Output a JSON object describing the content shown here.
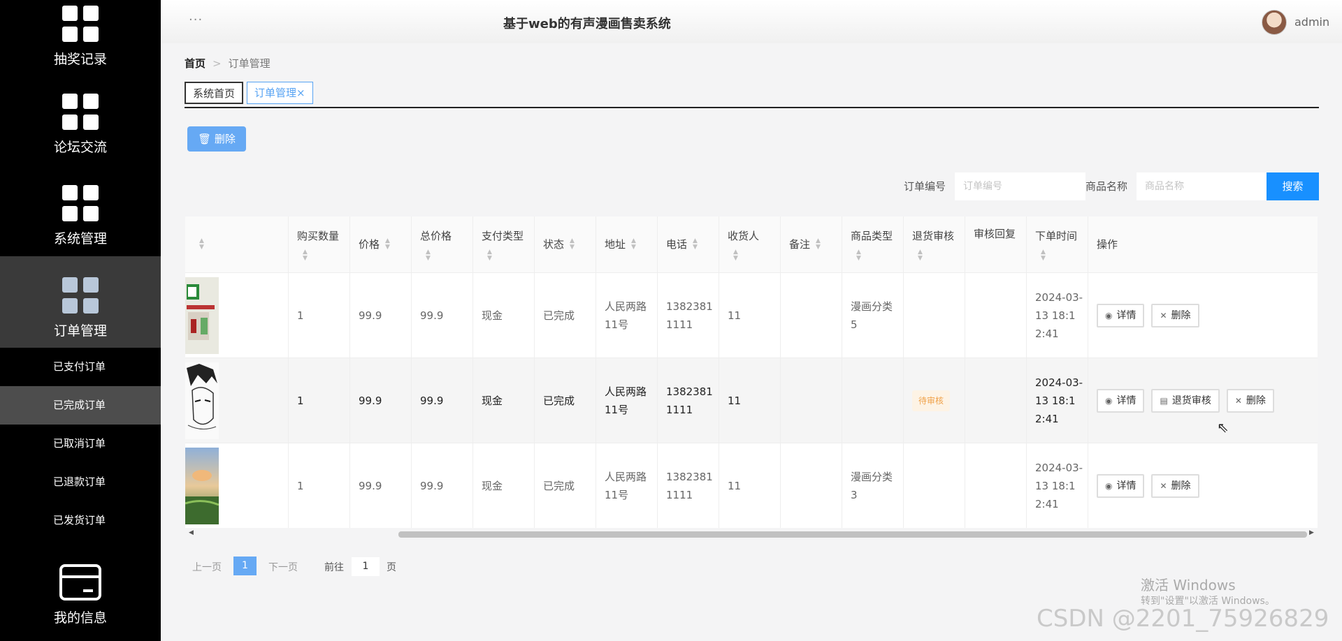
{
  "sidebar": {
    "items": [
      {
        "label": "抽奖记录"
      },
      {
        "label": "论坛交流"
      },
      {
        "label": "系统管理"
      },
      {
        "label": "订单管理"
      }
    ],
    "sub_items": [
      {
        "label": "已支付订单"
      },
      {
        "label": "已完成订单"
      },
      {
        "label": "已取消订单"
      },
      {
        "label": "已退款订单"
      },
      {
        "label": "已发货订单"
      }
    ],
    "bottom_item": {
      "label": "我的信息"
    }
  },
  "header": {
    "dots": "···",
    "title": "基于web的有声漫画售卖系统",
    "user": "admin"
  },
  "breadcrumb": {
    "home": "首页",
    "sep": ">",
    "current": "订单管理"
  },
  "tabs": {
    "home": "系统首页",
    "current": "订单管理",
    "close": "×"
  },
  "toolbar": {
    "delete_label": "删除"
  },
  "search": {
    "order_no_label": "订单编号",
    "order_no_placeholder": "订单编号",
    "product_label": "商品名称",
    "product_placeholder": "商品名称",
    "button": "搜索"
  },
  "table": {
    "headers": [
      "购买数量",
      "价格",
      "总价格",
      "支付类型",
      "状态",
      "地址",
      "电话",
      "收货人",
      "备注",
      "商品类型",
      "退货审核",
      "审核回复",
      "下单时间",
      "操作"
    ],
    "rows": [
      {
        "qty": "1",
        "price": "99.9",
        "total": "99.9",
        "pay": "现金",
        "status": "已完成",
        "addr": "人民两路11号",
        "phone": "13823811111",
        "receiver": "11",
        "remark": "",
        "type": "漫画分类5",
        "refund": "",
        "reply": "",
        "time": "2024-03-13 18:12:41",
        "ops": [
          "详情",
          "删除"
        ]
      },
      {
        "qty": "1",
        "price": "99.9",
        "total": "99.9",
        "pay": "现金",
        "status": "已完成",
        "addr": "人民两路11号",
        "phone": "13823811111",
        "receiver": "11",
        "remark": "",
        "type": "",
        "refund": "待审核",
        "reply": "",
        "time": "2024-03-13 18:12:41",
        "ops": [
          "详情",
          "退货审核",
          "删除"
        ]
      },
      {
        "qty": "1",
        "price": "99.9",
        "total": "99.9",
        "pay": "现金",
        "status": "已完成",
        "addr": "人民两路11号",
        "phone": "13823811111",
        "receiver": "11",
        "remark": "",
        "type": "漫画分类3",
        "refund": "",
        "reply": "",
        "time": "2024-03-13 18:12:41",
        "ops": [
          "详情",
          "删除"
        ]
      }
    ]
  },
  "pagination": {
    "prev": "上一页",
    "current": "1",
    "next": "下一页",
    "goto": "前往",
    "goto_value": "1",
    "page_unit": "页"
  },
  "watermark": {
    "win_title": "激活 Windows",
    "win_sub": "转到\"设置\"以激活 Windows。",
    "csdn": "CSDN @2201_75926829"
  },
  "colors": {
    "primary": "#1890ff",
    "light_primary": "#66a9f4",
    "sidebar_bg": "#000000",
    "warn_tag": "#f0a24a"
  }
}
